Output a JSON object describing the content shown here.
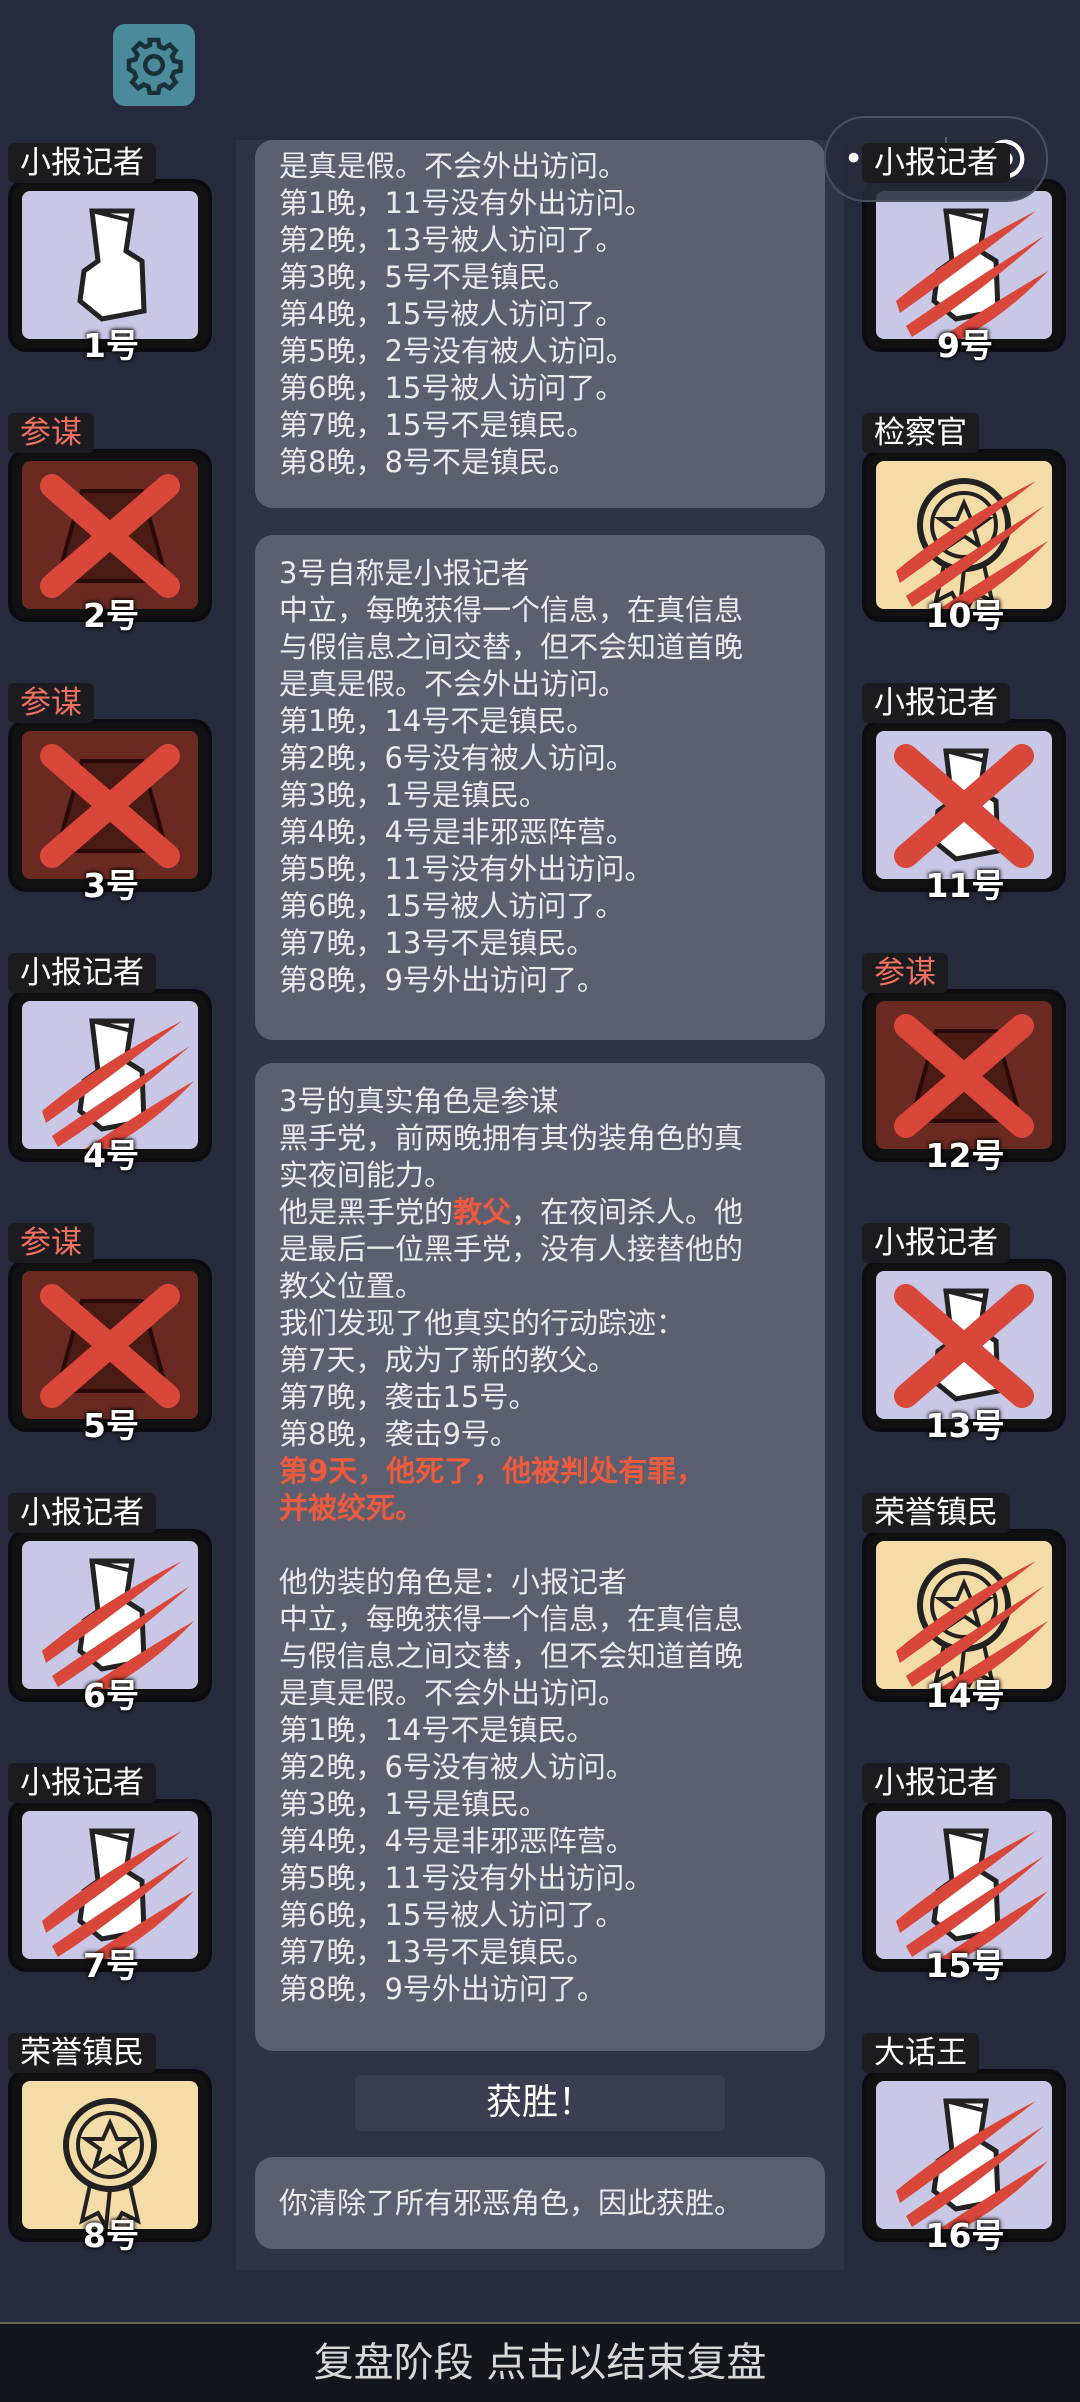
{
  "header": {
    "settings_icon": "gear-icon",
    "capsule_icon": "menu-dots-icon",
    "capsule_close_icon": "target-icon"
  },
  "colors": {
    "background": "#262a3d",
    "card": "#5b5f6f",
    "highlight": "#ee5a3c",
    "reporter_tile": "#c8c8e6",
    "evil_tile": "#6a2a22",
    "honor_tile": "#f4dca8"
  },
  "left_players": [
    {
      "role": "小报记者",
      "number": "1号",
      "status": "alive",
      "kind": "reporter"
    },
    {
      "role": "参谋",
      "number": "2号",
      "status": "crossed",
      "kind": "evil"
    },
    {
      "role": "参谋",
      "number": "3号",
      "status": "crossed",
      "kind": "evil"
    },
    {
      "role": "小报记者",
      "number": "4号",
      "status": "clawed",
      "kind": "reporter"
    },
    {
      "role": "参谋",
      "number": "5号",
      "status": "crossed",
      "kind": "evil"
    },
    {
      "role": "小报记者",
      "number": "6号",
      "status": "clawed",
      "kind": "reporter"
    },
    {
      "role": "小报记者",
      "number": "7号",
      "status": "clawed",
      "kind": "reporter"
    },
    {
      "role": "荣誉镇民",
      "number": "8号",
      "status": "alive",
      "kind": "honor"
    }
  ],
  "right_players": [
    {
      "role": "小报记者",
      "number": "9号",
      "status": "clawed",
      "kind": "reporter"
    },
    {
      "role": "检察官",
      "number": "10号",
      "status": "clawed",
      "kind": "honor"
    },
    {
      "role": "小报记者",
      "number": "11号",
      "status": "crossed",
      "kind": "reporter"
    },
    {
      "role": "参谋",
      "number": "12号",
      "status": "crossed",
      "kind": "evil"
    },
    {
      "role": "小报记者",
      "number": "13号",
      "status": "crossed",
      "kind": "reporter"
    },
    {
      "role": "荣誉镇民",
      "number": "14号",
      "status": "clawed",
      "kind": "honor"
    },
    {
      "role": "小报记者",
      "number": "15号",
      "status": "clawed",
      "kind": "reporter"
    },
    {
      "role": "大话王",
      "number": "16号",
      "status": "clawed",
      "kind": "reporter"
    }
  ],
  "cards": {
    "card1": [
      "是真是假。不会外出访问。",
      "第1晚，11号没有外出访问。",
      "第2晚，13号被人访问了。",
      "第3晚，5号不是镇民。",
      "第4晚，15号被人访问了。",
      "第5晚，2号没有被人访问。",
      "第6晚，15号被人访问了。",
      "第7晚，15号不是镇民。",
      "第8晚，8号不是镇民。"
    ],
    "card2": [
      "3号自称是小报记者",
      "中立，每晚获得一个信息，在真信息",
      "与假信息之间交替，但不会知道首晚",
      "是真是假。不会外出访问。",
      "第1晚，14号不是镇民。",
      "第2晚，6号没有被人访问。",
      "第3晚，1号是镇民。",
      "第4晚，4号是非邪恶阵营。",
      "第5晚，11号没有外出访问。",
      "第6晚，15号被人访问了。",
      "第7晚，13号不是镇民。",
      "第8晚，9号外出访问了。"
    ],
    "card3": {
      "intro": [
        "3号的真实角色是参谋",
        "黑手党，前两晚拥有其伪装角色的真",
        "实夜间能力。"
      ],
      "godfather_prefix": "他是黑手党的",
      "godfather_word": "教父",
      "godfather_suffix": "，在夜间杀人。他",
      "godfather_rest": [
        "是最后一位黑手党，没有人接替他的",
        "教父位置。"
      ],
      "trace": [
        "我们发现了他真实的行动踪迹：",
        "第7天，成为了新的教父。",
        "第7晚，袭击15号。",
        "第8晚，袭击9号。"
      ],
      "death": [
        "第9天，他死了，他被判处有罪，",
        "并被绞死。"
      ],
      "disguise": [
        "他伪装的角色是：小报记者",
        "中立，每晚获得一个信息，在真信息",
        "与假信息之间交替，但不会知道首晚",
        "是真是假。不会外出访问。",
        "第1晚，14号不是镇民。",
        "第2晚，6号没有被人访问。",
        "第3晚，1号是镇民。",
        "第4晚，4号是非邪恶阵营。",
        "第5晚，11号没有外出访问。",
        "第6晚，15号被人访问了。",
        "第7晚，13号不是镇民。",
        "第8晚，9号外出访问了。"
      ]
    },
    "win_title": "获胜！",
    "win_text": "你清除了所有邪恶角色，因此获胜。"
  },
  "footer": {
    "label": "复盘阶段 点击以结束复盘"
  }
}
